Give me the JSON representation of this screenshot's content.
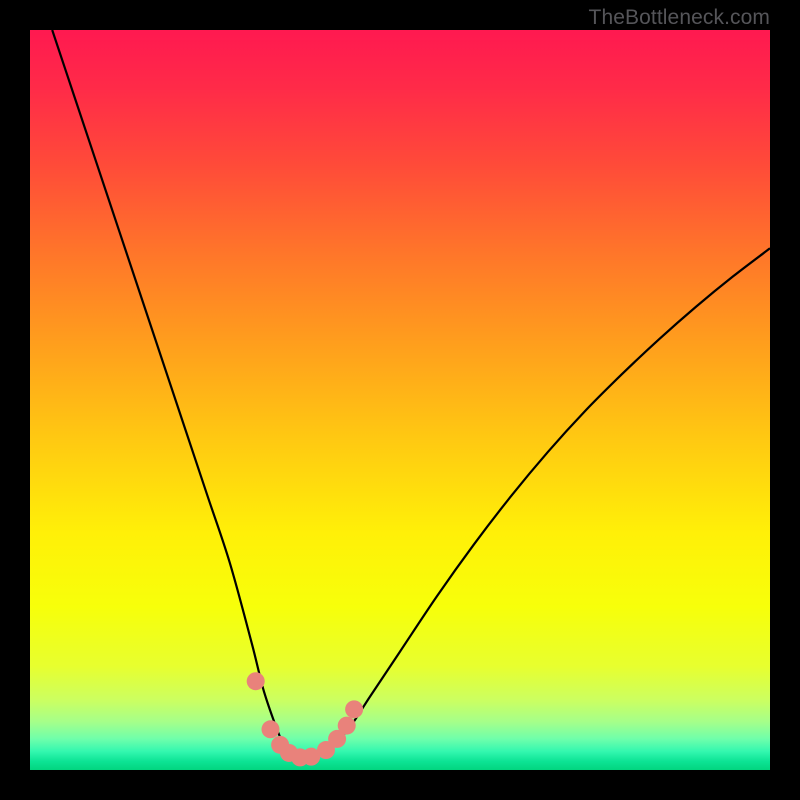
{
  "watermark": "TheBottleneck.com",
  "chart_data": {
    "type": "line",
    "title": "",
    "xlabel": "",
    "ylabel": "",
    "xlim": [
      0,
      100
    ],
    "ylim": [
      0,
      100
    ],
    "curve": {
      "x": [
        3,
        6,
        9,
        12,
        15,
        18,
        21,
        24,
        27,
        30,
        31.5,
        33,
        34,
        35,
        36,
        37,
        38,
        40,
        43,
        46,
        50,
        55,
        60,
        65,
        70,
        75,
        80,
        85,
        90,
        95,
        100
      ],
      "y": [
        100,
        91,
        82,
        73,
        64,
        55,
        46,
        37,
        28,
        17,
        11,
        6.5,
        4,
        2.3,
        1.5,
        1.3,
        1.5,
        2.5,
        5.5,
        10,
        16,
        23.5,
        30.5,
        37,
        43,
        48.5,
        53.5,
        58.2,
        62.6,
        66.7,
        70.5
      ]
    },
    "marker_points": {
      "x": [
        30.5,
        32.5,
        33.8,
        35.0,
        36.5,
        38.0,
        40.0,
        41.5,
        42.8,
        43.8
      ],
      "y": [
        12.0,
        5.5,
        3.4,
        2.3,
        1.7,
        1.8,
        2.7,
        4.2,
        6.0,
        8.2
      ]
    },
    "marker_style": {
      "color": "#e9827b",
      "radius_px": 9
    },
    "background_gradient": {
      "stops": [
        {
          "offset": 0.0,
          "color": "#ff1950"
        },
        {
          "offset": 0.08,
          "color": "#ff2b48"
        },
        {
          "offset": 0.18,
          "color": "#ff4a39"
        },
        {
          "offset": 0.3,
          "color": "#ff752a"
        },
        {
          "offset": 0.42,
          "color": "#ff9d1d"
        },
        {
          "offset": 0.55,
          "color": "#ffc812"
        },
        {
          "offset": 0.68,
          "color": "#fff008"
        },
        {
          "offset": 0.78,
          "color": "#f7ff0a"
        },
        {
          "offset": 0.86,
          "color": "#e7ff2f"
        },
        {
          "offset": 0.905,
          "color": "#ccff60"
        },
        {
          "offset": 0.935,
          "color": "#a5ff8a"
        },
        {
          "offset": 0.958,
          "color": "#6fffab"
        },
        {
          "offset": 0.975,
          "color": "#33f7af"
        },
        {
          "offset": 0.988,
          "color": "#0de495"
        },
        {
          "offset": 1.0,
          "color": "#02d57f"
        }
      ]
    }
  }
}
